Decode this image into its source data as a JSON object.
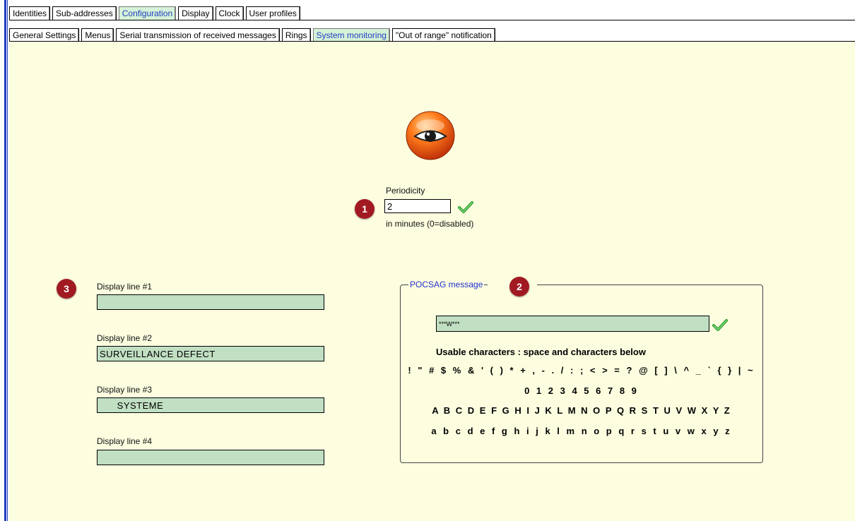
{
  "tabs_top": [
    "Identities",
    "Sub-addresses",
    "Configuration",
    "Display",
    "Clock",
    "User profiles"
  ],
  "tabs_sub": [
    "General Settings",
    "Menus",
    "Serial transmission of received messages",
    "Rings",
    "System monitoring",
    "\"Out of range\" notification"
  ],
  "active_top": "Configuration",
  "active_sub": "System monitoring",
  "periodicity": {
    "label": "Periodicity",
    "value": "2",
    "hint": "in minutes (0=disabled)",
    "badge": "1"
  },
  "display_lines": {
    "badge": "3",
    "lines": [
      {
        "label": "Display line #1",
        "value": ""
      },
      {
        "label": "Display line #2",
        "value": "SURVEILLANCE DEFECT"
      },
      {
        "label": "Display line #3",
        "value": "      SYSTEME"
      },
      {
        "label": "Display line #4",
        "value": ""
      }
    ]
  },
  "pocsag": {
    "title": "POCSAG message",
    "badge": "2",
    "value": "***W***",
    "usable_title": "Usable characters : space and characters below",
    "rows": [
      "! \" # $ % & ' ( ) * + , - . / : ; < > = ? @ [ ] \\ ^ _ ` { } | ~",
      "0 1 2 3 4 5 6 7 8 9",
      "A B C D E F G H I J K L M N O P Q R S T U V W X Y Z",
      "a b c d e f g h i j k l m n o p q r s t u v w x y z"
    ]
  },
  "colors": {
    "panel_bg": "#fdfde0",
    "field_green": "#c1dfc2",
    "badge_red": "#a11a22",
    "active_tab_bg": "#d6f2d8",
    "accent_blue": "#1f3fbf"
  },
  "icons": {
    "monitor": "eye-icon",
    "valid": "check-icon"
  }
}
